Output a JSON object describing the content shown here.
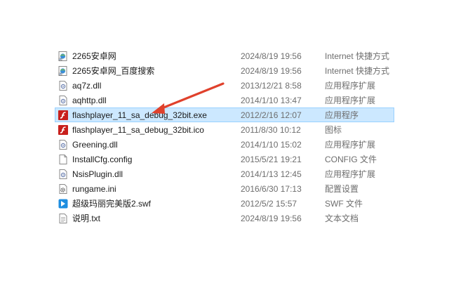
{
  "files": [
    {
      "name": "2265安卓网",
      "date": "2024/8/19 19:56",
      "type": "Internet 快捷方式",
      "icon": "internet-shortcut-icon",
      "selected": false
    },
    {
      "name": "2265安卓网_百度搜索",
      "date": "2024/8/19 19:56",
      "type": "Internet 快捷方式",
      "icon": "internet-shortcut-icon",
      "selected": false
    },
    {
      "name": "aq7z.dll",
      "date": "2013/12/21 8:58",
      "type": "应用程序扩展",
      "icon": "dll-file-icon",
      "selected": false
    },
    {
      "name": "aqhttp.dll",
      "date": "2014/1/10 13:47",
      "type": "应用程序扩展",
      "icon": "dll-file-icon",
      "selected": false
    },
    {
      "name": "flashplayer_11_sa_debug_32bit.exe",
      "date": "2012/2/16 12:07",
      "type": "应用程序",
      "icon": "flash-player-icon",
      "selected": true
    },
    {
      "name": "flashplayer_11_sa_debug_32bit.ico",
      "date": "2011/8/30 10:12",
      "type": "图标",
      "icon": "flash-player-icon",
      "selected": false
    },
    {
      "name": "Greening.dll",
      "date": "2014/1/10 15:02",
      "type": "应用程序扩展",
      "icon": "dll-file-icon",
      "selected": false
    },
    {
      "name": "InstallCfg.config",
      "date": "2015/5/21 19:21",
      "type": "CONFIG 文件",
      "icon": "blank-file-icon",
      "selected": false
    },
    {
      "name": "NsisPlugin.dll",
      "date": "2014/1/13 12:45",
      "type": "应用程序扩展",
      "icon": "dll-file-icon",
      "selected": false
    },
    {
      "name": "rungame.ini",
      "date": "2016/6/30 17:13",
      "type": "配置设置",
      "icon": "settings-file-icon",
      "selected": false
    },
    {
      "name": "超级玛丽完美版2.swf",
      "date": "2012/5/2 15:57",
      "type": "SWF 文件",
      "icon": "swf-file-icon",
      "selected": false
    },
    {
      "name": "说明.txt",
      "date": "2024/8/19 19:56",
      "type": "文本文档",
      "icon": "text-file-icon",
      "selected": false
    }
  ],
  "colors": {
    "selection": "#cce8ff",
    "selection_border": "#99d1ff",
    "arrow": "#e0412c",
    "flash": "#c8201d"
  }
}
